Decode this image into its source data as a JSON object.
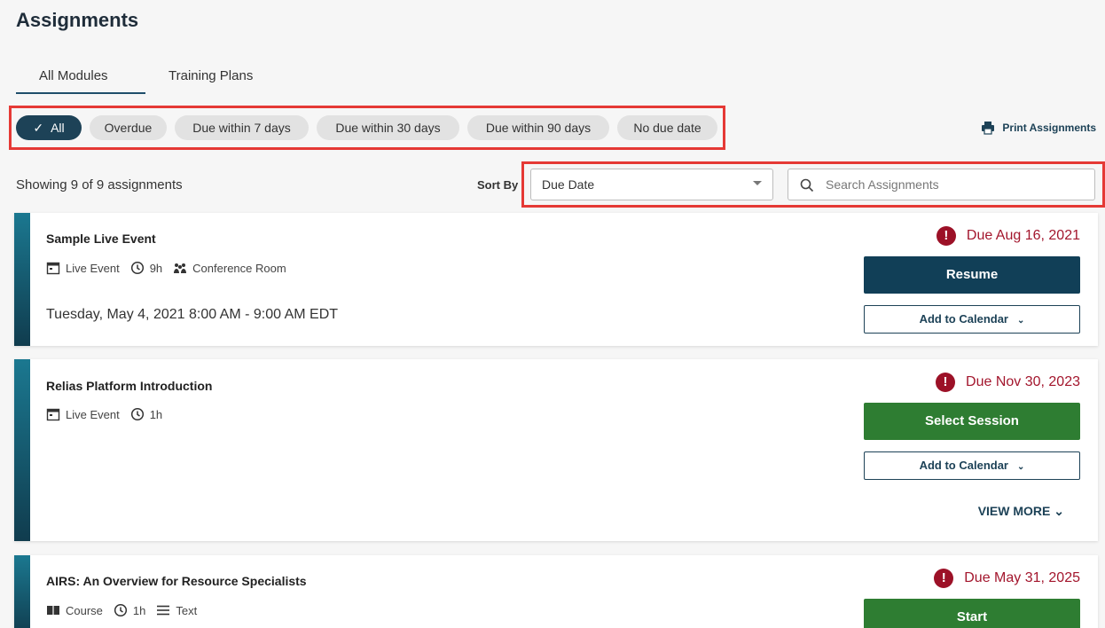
{
  "page": {
    "title": "Assignments"
  },
  "tabs": [
    "All Modules",
    "Training Plans"
  ],
  "filters": {
    "chips": [
      "All",
      "Overdue",
      "Due within 7 days",
      "Due within 30 days",
      "Due within 90 days",
      "No due date"
    ],
    "active": "All"
  },
  "print_label": "Print Assignments",
  "summary": {
    "showing": "Showing 9 of 9 assignments"
  },
  "sort": {
    "label": "Sort By",
    "value": "Due Date"
  },
  "search": {
    "placeholder": "Search Assignments"
  },
  "colors": {
    "primary": "#1d4257",
    "green": "#2e7d32",
    "due_red": "#a3162d",
    "highlight": "#e53935"
  },
  "assignments": [
    {
      "title": "Sample Live Event",
      "type": "Live Event",
      "duration": "9h",
      "location": "Conference Room",
      "session": "Tuesday, May 4, 2021 8:00 AM - 9:00 AM EDT",
      "due": "Due Aug 16, 2021",
      "action": "Resume",
      "calendar": "Add to Calendar"
    },
    {
      "title": "Relias Platform Introduction",
      "type": "Live Event",
      "duration": "1h",
      "due": "Due Nov 30, 2023",
      "action": "Select Session",
      "calendar": "Add to Calendar",
      "more": "VIEW MORE"
    },
    {
      "title": "AIRS: An Overview for Resource Specialists",
      "type": "Course",
      "duration": "1h",
      "format": "Text",
      "due": "Due May 31, 2025",
      "action": "Start"
    }
  ]
}
